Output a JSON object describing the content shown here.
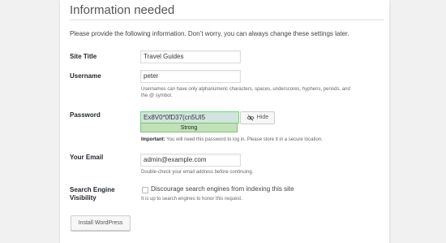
{
  "header": {
    "title": "Information needed",
    "intro": "Please provide the following information. Don’t worry, you can always change these settings later."
  },
  "site_title": {
    "label": "Site Title",
    "value": "Travel Guides"
  },
  "username": {
    "label": "Username",
    "value": "peter",
    "help_line1": "Usernames can have only alphanumeric characters, spaces, underscores, hyphens, periods, and",
    "help_line2": "the @ symbol."
  },
  "password": {
    "label": "Password",
    "value": "Ex8V0*0fD37(cn5UI5",
    "strength": "Strong",
    "hide_label": "Hide",
    "important_label": "Important:",
    "important_text": " You will need this password to log in. Please store it in a secure location."
  },
  "email": {
    "label": "Your Email",
    "value": "admin@example.com",
    "help": "Double-check your email address before continuing."
  },
  "search_engine": {
    "label_line1": "Search Engine",
    "label_line2": "Visibility",
    "checkbox_label": "Discourage search engines from indexing this site",
    "checked": false,
    "help": "It is up to search engines to honor this request."
  },
  "actions": {
    "install_label": "Install WordPress"
  },
  "icons": {
    "hide": "eye-slash-icon"
  }
}
